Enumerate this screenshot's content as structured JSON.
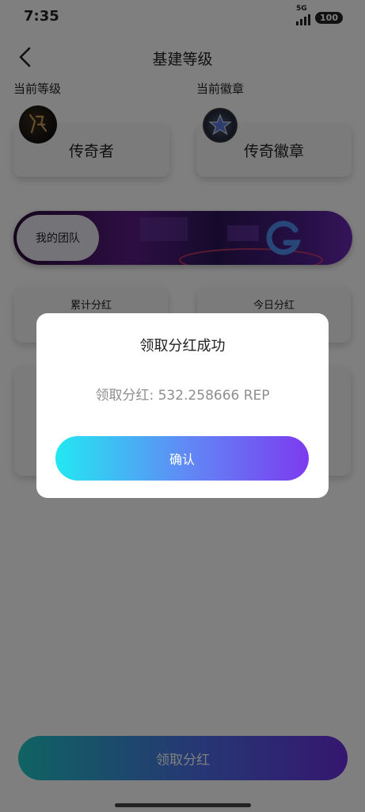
{
  "status_bar": {
    "time": "7:35",
    "network": "5G",
    "battery": "100"
  },
  "header": {
    "title": "基建等级"
  },
  "level": {
    "label": "当前等级",
    "value": "传奇者"
  },
  "badge": {
    "label": "当前徽章",
    "value": "传奇徽章"
  },
  "team": {
    "label": "我的团队"
  },
  "stats": {
    "total_label": "累计分红",
    "today_label": "今日分红"
  },
  "claim_button": {
    "label": "领取分红"
  },
  "dialog": {
    "title": "领取分红成功",
    "message": "领取分红: 532.258666 REP",
    "confirm_label": "确认"
  },
  "colors": {
    "claim_gradient": [
      "#1fc6c6",
      "#6a2ee0"
    ],
    "confirm_gradient": [
      "#23e8f2",
      "#7c3bf0"
    ]
  }
}
